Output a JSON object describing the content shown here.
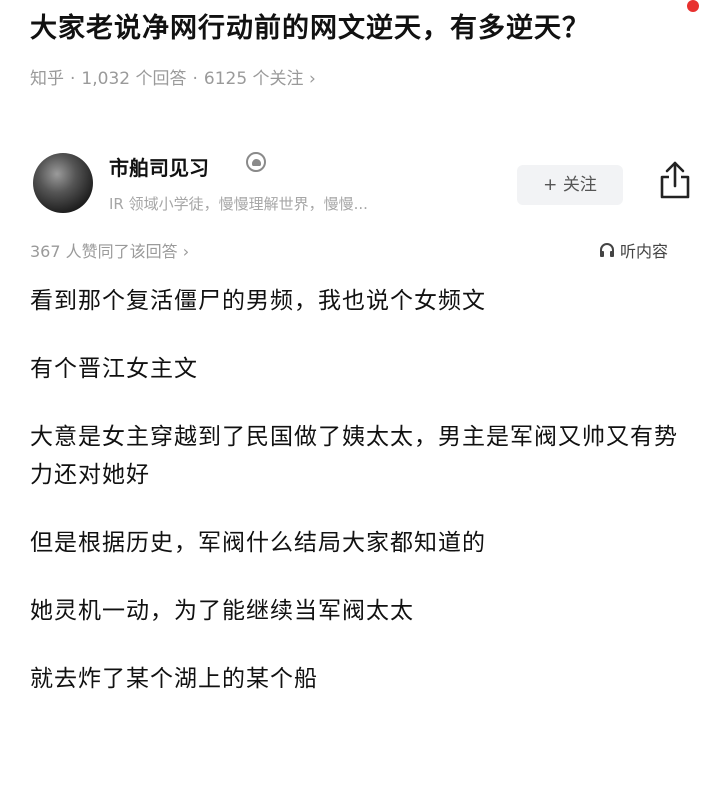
{
  "question": {
    "title": "大家老说净网行动前的网文逆天，有多逆天？",
    "source": "知乎",
    "answers": "1,032 个回答",
    "followers": "6125 个关注",
    "chevron": "›"
  },
  "author": {
    "name": "市舶司见习",
    "bio": "IR 领域小学徒，慢慢理解世界，慢慢...",
    "follow_label": "+ 关注",
    "badge_icon": "badge-icon",
    "share_icon": "share-icon"
  },
  "answer": {
    "votes": "367 人赞同了该回答 ›",
    "listen_label": "听内容",
    "paragraphs": [
      "看到那个复活僵尸的男频，我也说个女频文",
      "有个晋江女主文",
      "大意是女主穿越到了民国做了姨太太，男主是军阀又帅又有势力还对她好",
      "但是根据历史，军阀什么结局大家都知道的",
      "她灵机一动，为了能继续当军阀太太",
      "就去炸了某个湖上的某个船"
    ]
  },
  "colors": {
    "accent_red": "#e8312f",
    "meta_gray": "#9a9a9a",
    "button_bg": "#f2f3f5"
  }
}
